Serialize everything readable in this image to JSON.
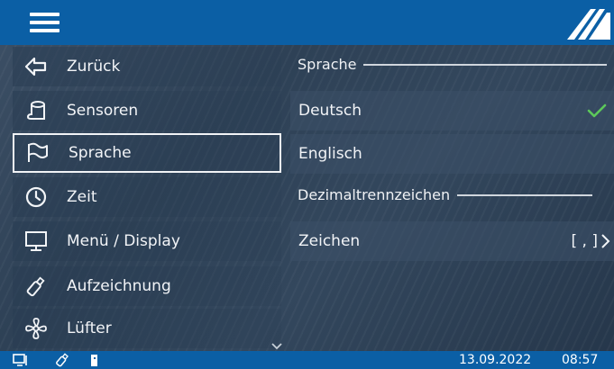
{
  "header": {
    "menu_icon": "hamburger-menu-icon",
    "logo_icon": "brand-logo-icon"
  },
  "sidebar": {
    "items": [
      {
        "label": "Zurück",
        "icon": "back-arrow-icon"
      },
      {
        "label": "Sensoren",
        "icon": "sensor-icon"
      },
      {
        "label": "Sprache",
        "icon": "flag-icon",
        "active": true
      },
      {
        "label": "Zeit",
        "icon": "clock-icon"
      },
      {
        "label": "Menü / Display",
        "icon": "monitor-icon"
      },
      {
        "label": "Aufzeichnung",
        "icon": "usb-stick-icon"
      },
      {
        "label": "Lüfter",
        "icon": "fan-icon"
      }
    ],
    "scroll_icon": "chevron-down-icon"
  },
  "content": {
    "language_section": "Sprache",
    "options": [
      {
        "label": "Deutsch",
        "selected": true
      },
      {
        "label": "Englisch",
        "selected": false
      }
    ],
    "decimal_section": "Dezimaltrennzeichen",
    "separator_row": {
      "label": "Zeichen",
      "value": "[ , ]"
    }
  },
  "statusbar": {
    "date": "13.09.2022",
    "time": "08:57"
  },
  "colors": {
    "header_blue": "#0b5fa5",
    "check_green": "#5cc85a",
    "text": "#f2f4f7"
  }
}
